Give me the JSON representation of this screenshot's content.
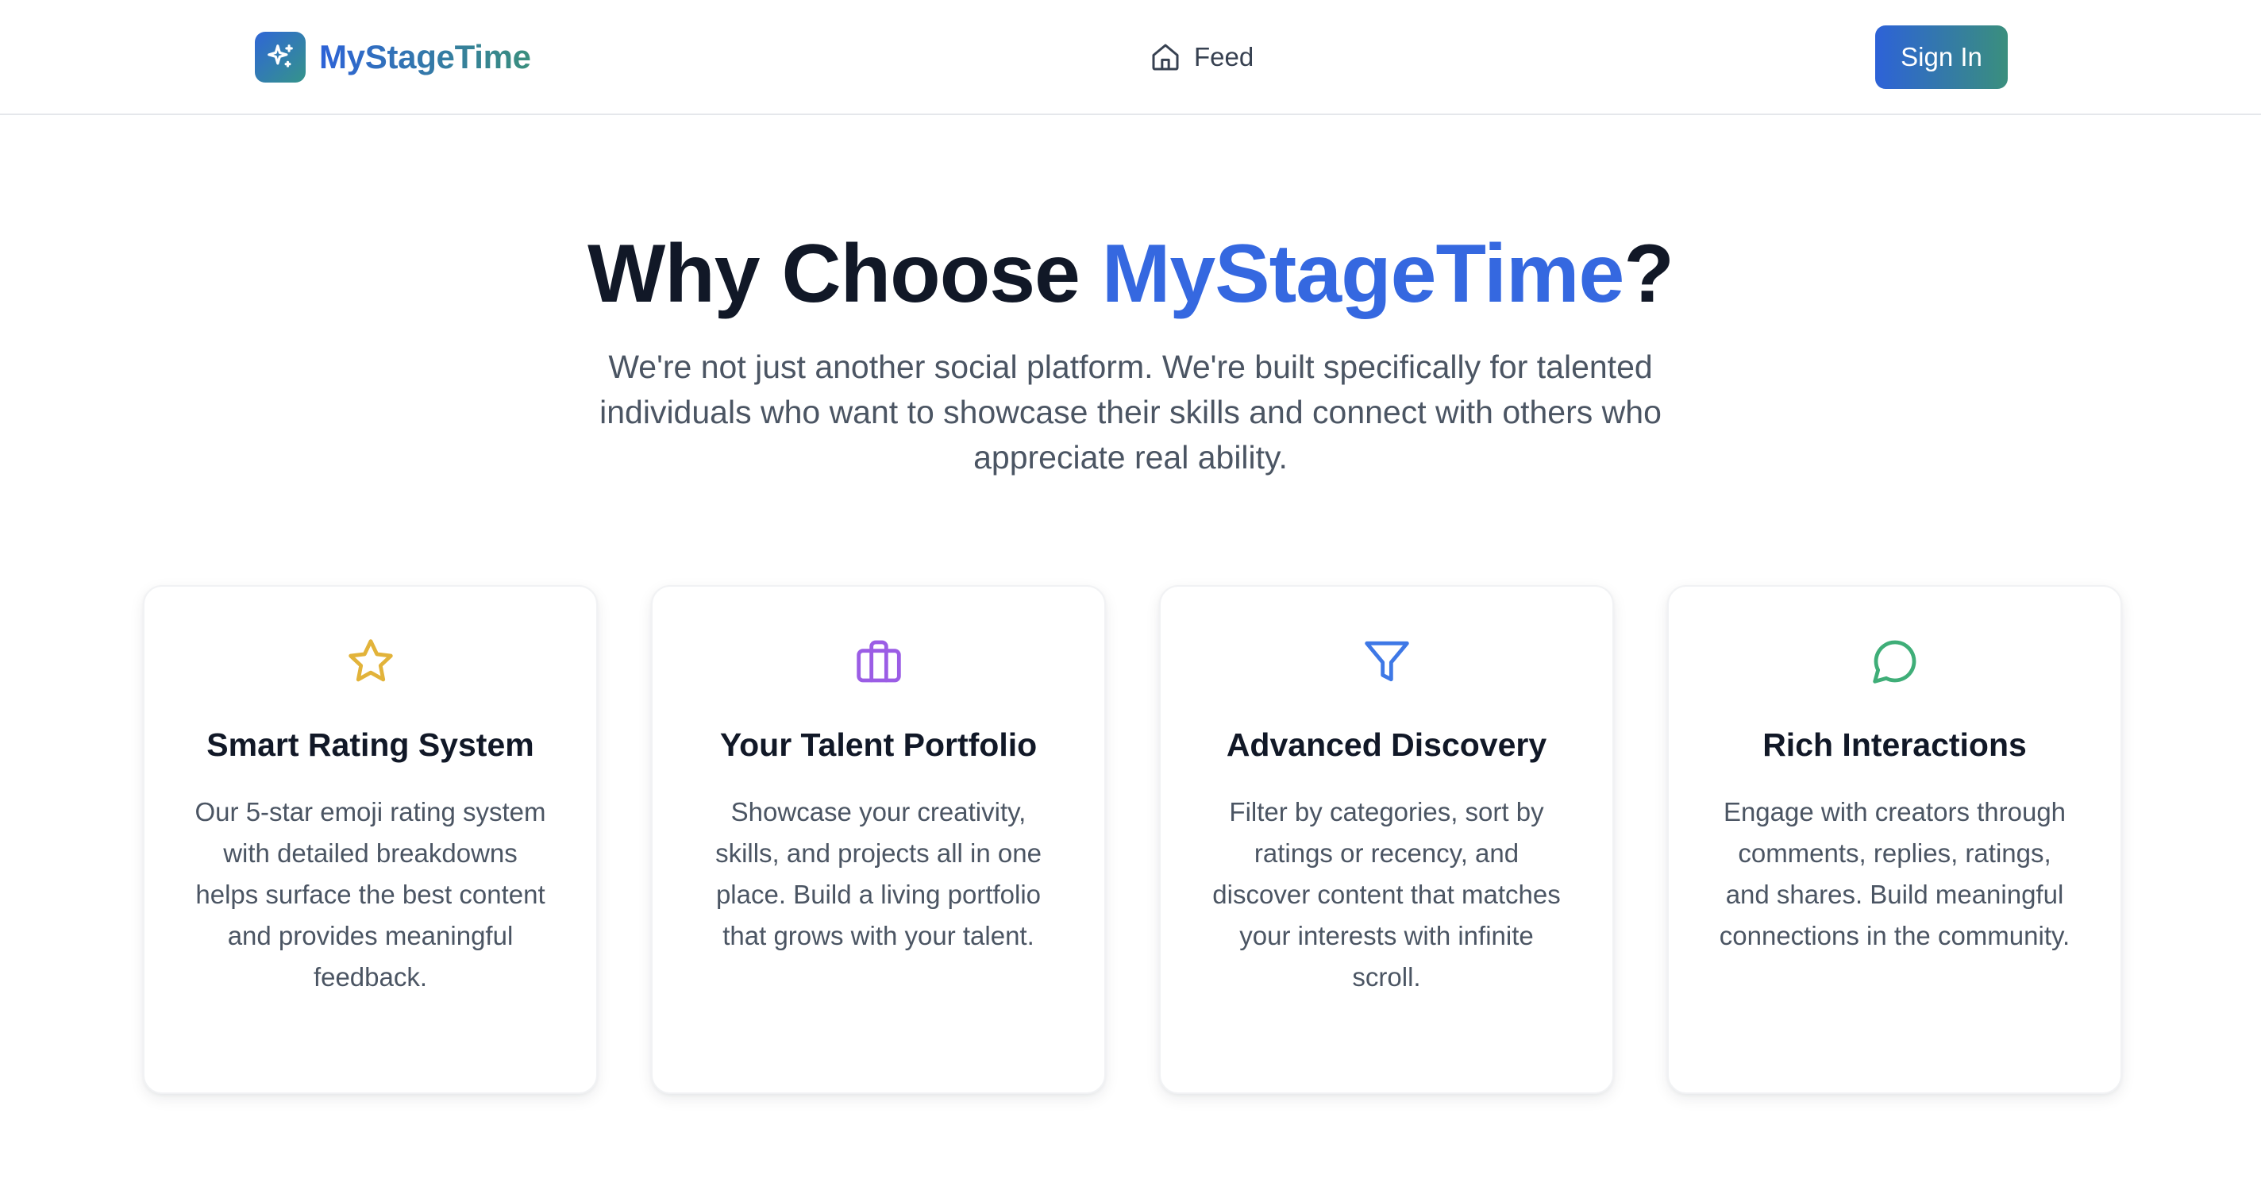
{
  "brand": {
    "name": "MyStageTime",
    "logo_icon": "sparkles-icon"
  },
  "nav": {
    "feed": {
      "label": "Feed",
      "icon": "home-icon"
    },
    "signin_label": "Sign In"
  },
  "hero": {
    "title_prefix": "Why Choose ",
    "title_accent": "MyStageTime",
    "title_suffix": "?",
    "subtitle": "We're not just another social platform. We're built specifically for talented individuals who want to showcase their skills and connect with others who appreciate real ability."
  },
  "features": [
    {
      "icon": "star-icon",
      "color": "#e2b33a",
      "title": "Smart Rating System",
      "description": "Our 5-star emoji rating system with detailed breakdowns helps surface the best content and provides meaningful feedback."
    },
    {
      "icon": "briefcase-icon",
      "color": "#9b5de5",
      "title": "Your Talent Portfolio",
      "description": "Showcase your creativity, skills, and projects all in one place. Build a living portfolio that grows with your talent."
    },
    {
      "icon": "filter-icon",
      "color": "#3e78e6",
      "title": "Advanced Discovery",
      "description": "Filter by categories, sort by ratings or recency, and discover content that matches your interests with infinite scroll."
    },
    {
      "icon": "message-circle-icon",
      "color": "#3fae78",
      "title": "Rich Interactions",
      "description": "Engage with creators through comments, replies, ratings, and shares. Build meaningful connections in the community."
    }
  ],
  "colors": {
    "brand_gradient_start": "#2d62d8",
    "brand_gradient_end": "#3a8f7d",
    "accent": "#3568e0"
  }
}
